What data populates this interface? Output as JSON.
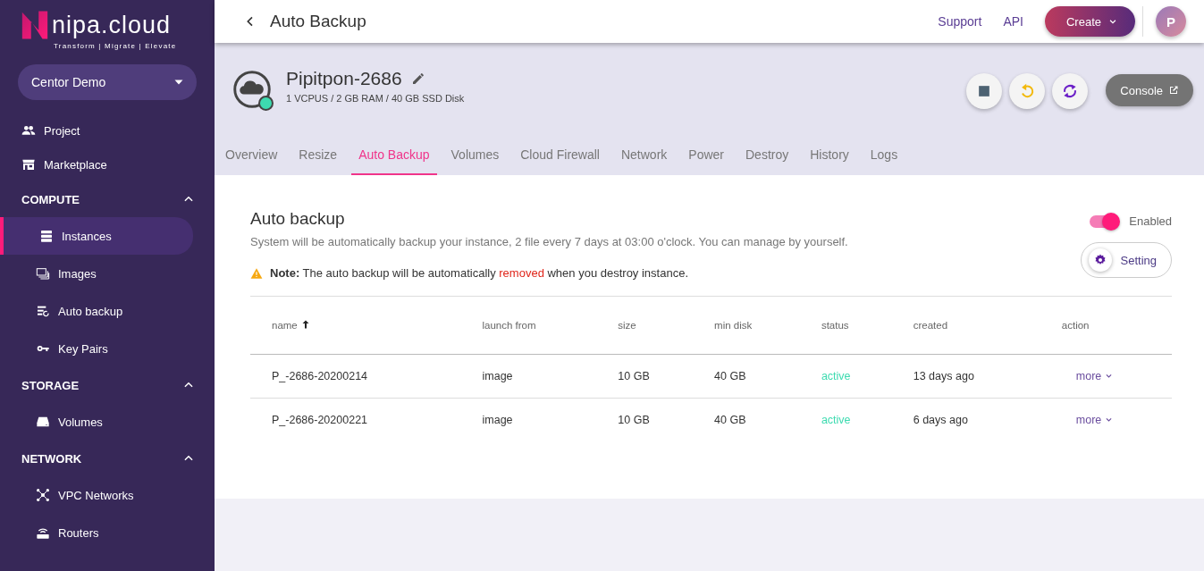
{
  "brand": {
    "name": "nipa.cloud",
    "tagline": "Transform | Migrate | Elevate"
  },
  "project_selector": {
    "value": "Centor Demo"
  },
  "sidebar": [
    {
      "kind": "link",
      "label": "Project",
      "selected": false
    },
    {
      "kind": "link",
      "label": "Marketplace",
      "selected": false
    },
    {
      "kind": "section",
      "label": "COMPUTE",
      "expanded": true,
      "children": [
        {
          "label": "Instances",
          "selected": true
        },
        {
          "label": "Images",
          "selected": false
        },
        {
          "label": "Auto backup",
          "selected": false
        },
        {
          "label": "Key Pairs",
          "selected": false
        }
      ]
    },
    {
      "kind": "section",
      "label": "STORAGE",
      "expanded": true,
      "children": [
        {
          "label": "Volumes",
          "selected": false
        }
      ]
    },
    {
      "kind": "section",
      "label": "NETWORK",
      "expanded": true,
      "children": [
        {
          "label": "VPC Networks",
          "selected": false
        },
        {
          "label": "Routers",
          "selected": false
        }
      ]
    }
  ],
  "header": {
    "title": "Auto Backup",
    "links": [
      "Support",
      "API"
    ],
    "create_button": "Create",
    "avatar": "P"
  },
  "instance": {
    "name": "Pipitpon-2686",
    "specs": "1 VCPUS / 2 GB RAM / 40 GB SSD Disk",
    "online": true,
    "console_button": "Console"
  },
  "tabs": [
    {
      "label": "Overview",
      "selected": false
    },
    {
      "label": "Resize",
      "selected": false
    },
    {
      "label": "Auto Backup",
      "selected": true
    },
    {
      "label": "Volumes",
      "selected": false
    },
    {
      "label": "Cloud Firewall",
      "selected": false
    },
    {
      "label": "Network",
      "selected": false
    },
    {
      "label": "Power",
      "selected": false
    },
    {
      "label": "Destroy",
      "selected": false
    },
    {
      "label": "History",
      "selected": false
    },
    {
      "label": "Logs",
      "selected": false
    }
  ],
  "auto_backup": {
    "title": "Auto backup",
    "description": "System will be automatically backup your instance, 2 file every 7 days at 03:00 o'clock. You can manage by yourself.",
    "toggle": {
      "label": "Enabled",
      "on": true
    },
    "setting_button": "Setting",
    "note": [
      {
        "kind": "bold",
        "text": "Note:"
      },
      {
        "kind": "plain",
        "text": " The auto backup will be automatically "
      },
      {
        "kind": "alert",
        "text": "removed"
      },
      {
        "kind": "plain",
        "text": " when you destroy instance."
      }
    ]
  },
  "table": {
    "columns": [
      {
        "label": "name",
        "sorted": true
      },
      {
        "label": "launch from",
        "sorted": false
      },
      {
        "label": "size",
        "sorted": false
      },
      {
        "label": "min disk",
        "sorted": false
      },
      {
        "label": "status",
        "sorted": false
      },
      {
        "label": "created",
        "sorted": false
      },
      {
        "label": "action",
        "sorted": false
      }
    ],
    "rows": [
      {
        "name": "P_-2686-20200214",
        "launch_from": "image",
        "size": "10 GB",
        "min_disk": "40 GB",
        "status": "active",
        "color": "#3ddbb0",
        "created": "13 days ago",
        "action": "more"
      },
      {
        "name": "P_-2686-20200221",
        "launch_from": "image",
        "size": "10 GB",
        "min_disk": "40 GB",
        "status": "active",
        "color": "#3ddbb0",
        "created": "6 days ago",
        "action": "more"
      }
    ]
  }
}
